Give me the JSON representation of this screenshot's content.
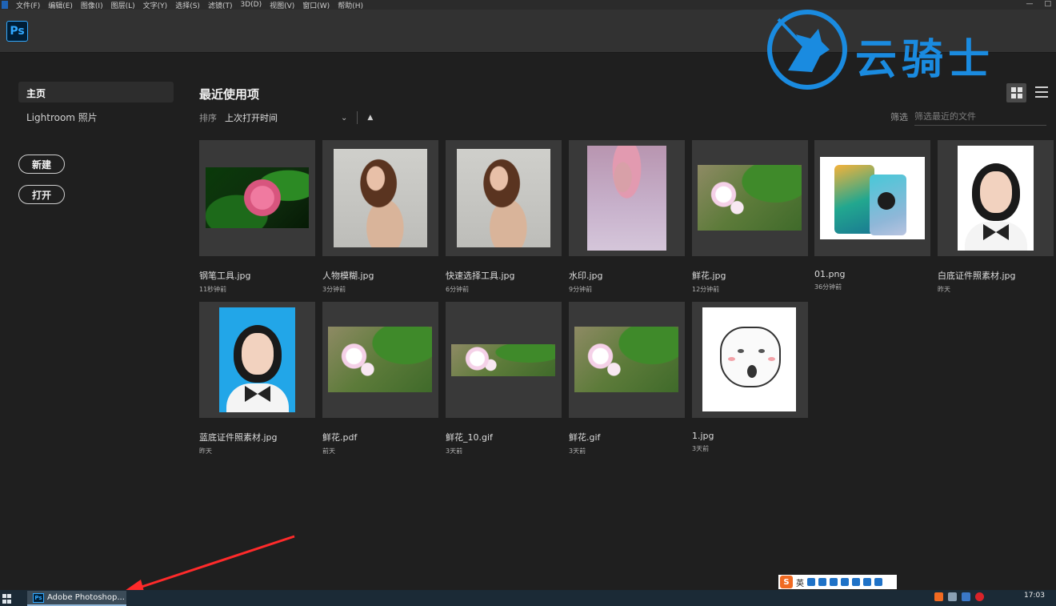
{
  "menubar": {
    "items": [
      "文件(F)",
      "编辑(E)",
      "图像(I)",
      "图层(L)",
      "文字(Y)",
      "选择(S)",
      "滤镜(T)",
      "3D(D)",
      "视图(V)",
      "窗口(W)",
      "帮助(H)"
    ],
    "minimize": "—",
    "maximize": "□"
  },
  "header": {
    "logo_text": "Ps"
  },
  "watermark": {
    "text": "云骑士"
  },
  "sidebar": {
    "home": "主页",
    "lightroom": "Lightroom 照片",
    "new_button": "新建",
    "open_button": "打开"
  },
  "main": {
    "title": "最近使用项",
    "sort_label": "排序",
    "sort_value": "上次打开时间",
    "filter_label": "筛选",
    "filter_placeholder": "筛选最近的文件"
  },
  "files": [
    {
      "name": "钢笔工具.jpg",
      "time": "11秒钟前"
    },
    {
      "name": "人物模糊.jpg",
      "time": "3分钟前"
    },
    {
      "name": "快速选择工具.jpg",
      "time": "6分钟前"
    },
    {
      "name": "水印.jpg",
      "time": "9分钟前"
    },
    {
      "name": "鲜花.jpg",
      "time": "12分钟前"
    },
    {
      "name": "01.png",
      "time": "36分钟前"
    },
    {
      "name": "白底证件照素材.jpg",
      "time": "昨天"
    },
    {
      "name": "蓝底证件照素材.jpg",
      "time": "昨天"
    },
    {
      "name": "鲜花.pdf",
      "time": "前天"
    },
    {
      "name": "鲜花_10.gif",
      "time": "3天前"
    },
    {
      "name": "鲜花.gif",
      "time": "3天前"
    },
    {
      "name": "1.jpg",
      "time": "3天前"
    }
  ],
  "taskbar": {
    "app_label": "Adobe Photoshop...",
    "app_icon": "Ps",
    "clock": "17:03"
  },
  "ime": {
    "logo": "S",
    "lang": "英"
  }
}
